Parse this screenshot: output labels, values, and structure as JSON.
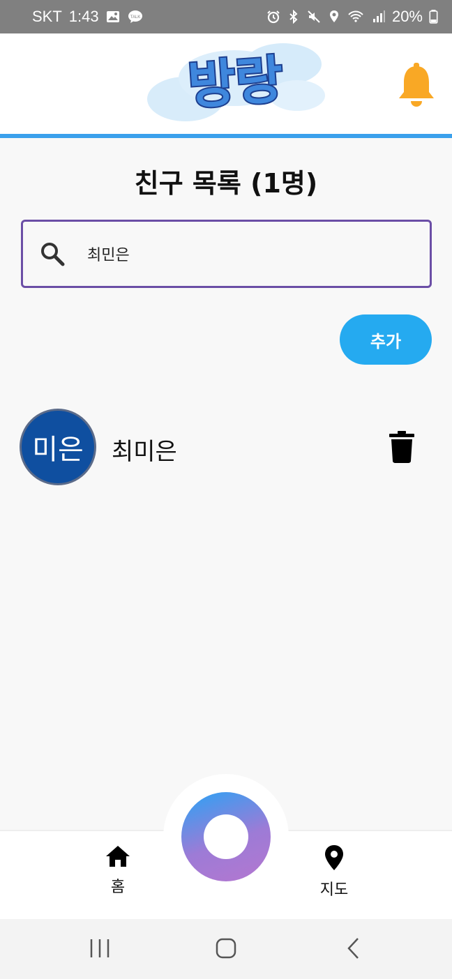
{
  "status_bar": {
    "carrier": "SKT",
    "time": "1:43",
    "battery": "20%",
    "left_icons": [
      "gallery-icon",
      "kakaotalk-icon"
    ],
    "right_icons": [
      "alarm-icon",
      "bluetooth-icon",
      "mute-icon",
      "location-icon",
      "wifi-icon",
      "signal-icon",
      "battery-icon"
    ]
  },
  "header": {
    "logo_text": "방랑",
    "bell_color": "#f9a825",
    "accent_line_color": "#3aa0ec"
  },
  "page": {
    "title": "친구 목록 (1명)"
  },
  "search": {
    "value": "최민은",
    "border_color": "#6b4ea6"
  },
  "add_button": {
    "label": "추가",
    "color": "#25aaf0"
  },
  "friends": [
    {
      "avatar_text": "미은",
      "name": "최미은"
    }
  ],
  "bottom_nav": {
    "items": [
      {
        "label": "홈",
        "icon": "home-icon"
      },
      {
        "label": "지도",
        "icon": "map-pin-icon"
      }
    ]
  }
}
